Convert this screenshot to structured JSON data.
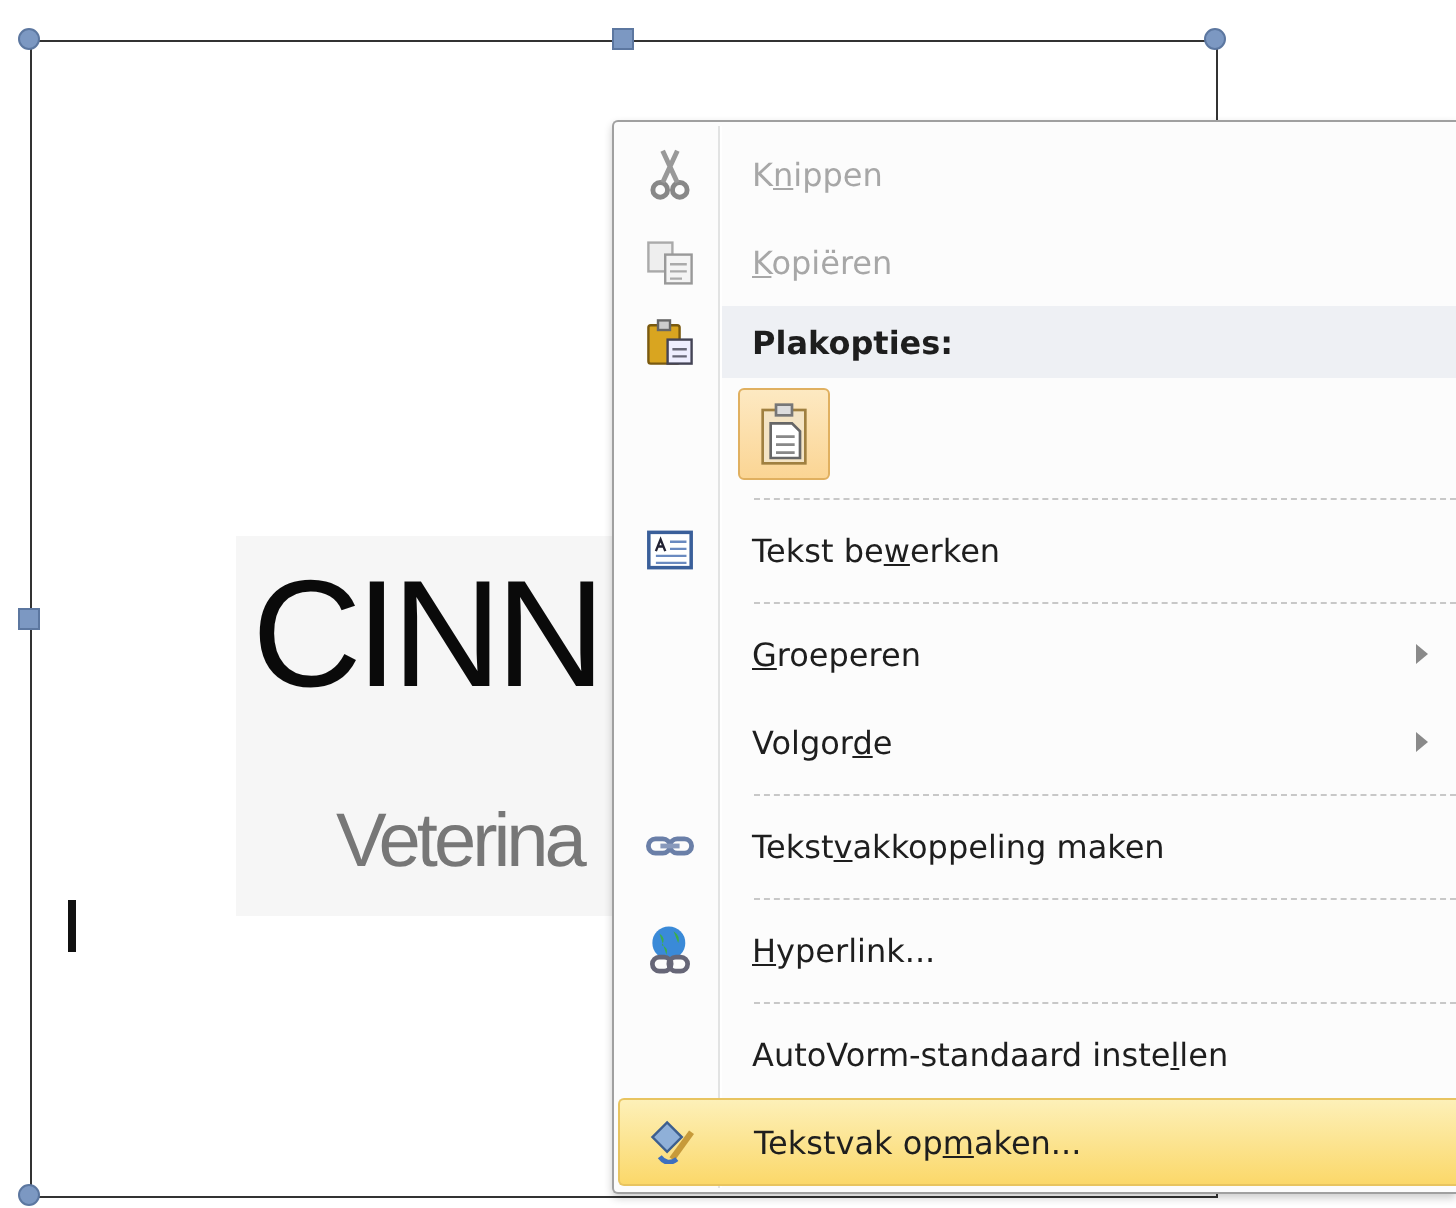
{
  "logo": {
    "title": "CINN",
    "subtitle": "Veterina"
  },
  "context_menu": {
    "items": [
      {
        "kind": "item",
        "label": {
          "before": "K",
          "key": "n",
          "after": "ippen"
        },
        "disabled": true,
        "submenu": false,
        "selected": false,
        "separator_after": false
      },
      {
        "kind": "item",
        "label": {
          "key": "K",
          "after": "opiëren"
        },
        "disabled": true,
        "submenu": false,
        "selected": false,
        "separator_after": false
      },
      {
        "kind": "header",
        "label": {
          "before": "Plakopties:"
        }
      },
      {
        "kind": "paste_options",
        "separator_after": true
      },
      {
        "kind": "item",
        "label": {
          "before": "Tekst be",
          "key": "w",
          "after": "erken"
        },
        "disabled": false,
        "submenu": false,
        "selected": false,
        "separator_after": true
      },
      {
        "kind": "item",
        "label": {
          "key": "G",
          "after": "roeperen"
        },
        "disabled": false,
        "submenu": true,
        "selected": false,
        "separator_after": false
      },
      {
        "kind": "item",
        "label": {
          "before": "Volgor",
          "key": "d",
          "after": "e"
        },
        "disabled": false,
        "submenu": true,
        "selected": false,
        "separator_after": true
      },
      {
        "kind": "item",
        "label": {
          "before": "Tekst",
          "key": "v",
          "after": "akkoppeling maken"
        },
        "disabled": false,
        "submenu": false,
        "selected": false,
        "separator_after": true
      },
      {
        "kind": "item",
        "label": {
          "key": "H",
          "after": "yperlink..."
        },
        "disabled": false,
        "submenu": false,
        "selected": false,
        "separator_after": true
      },
      {
        "kind": "item",
        "label": {
          "before": "AutoVorm-standaard inste",
          "key": "l",
          "after": "len"
        },
        "disabled": false,
        "submenu": false,
        "selected": false,
        "separator_after": false
      },
      {
        "kind": "item",
        "label": {
          "before": "Tekstvak op",
          "key": "m",
          "after": "aken..."
        },
        "disabled": false,
        "submenu": false,
        "selected": true,
        "separator_after": false
      }
    ]
  }
}
